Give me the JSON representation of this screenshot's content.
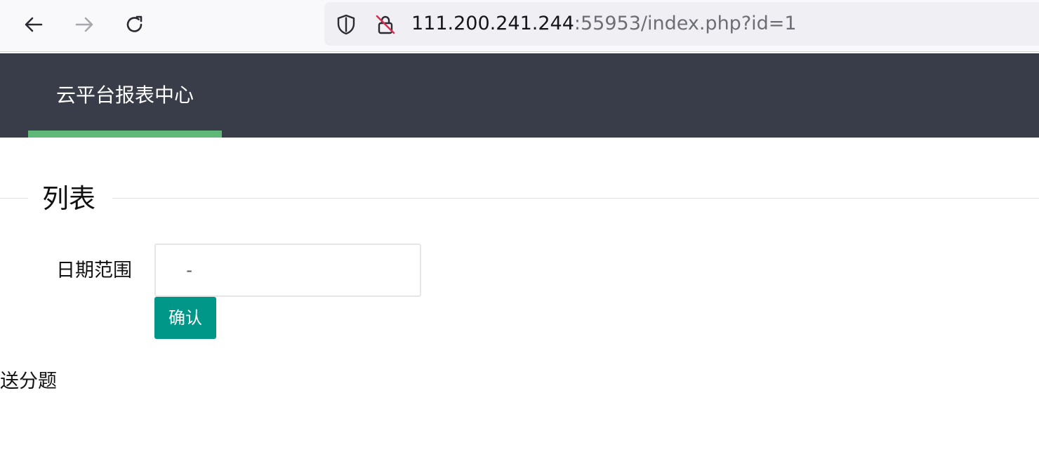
{
  "browser": {
    "nav": {
      "back_icon": "arrow-left-icon",
      "forward_icon": "arrow-right-icon",
      "reload_icon": "reload-icon"
    },
    "url": {
      "host": "111.200.241.244",
      "rest": ":55953/index.php?id=1",
      "shield_icon": "shield-icon",
      "insecure_icon": "insecure-lock-icon"
    }
  },
  "header": {
    "brand": "云平台报表中心",
    "background_color": "#393d49",
    "active_tab_color": "#5fb878"
  },
  "section": {
    "title": "列表"
  },
  "form": {
    "date_range_label": "日期范围",
    "date_range_value": "  -  ",
    "confirm_label": "确认",
    "confirm_color": "#009688"
  },
  "content": {
    "text": "送分题"
  }
}
